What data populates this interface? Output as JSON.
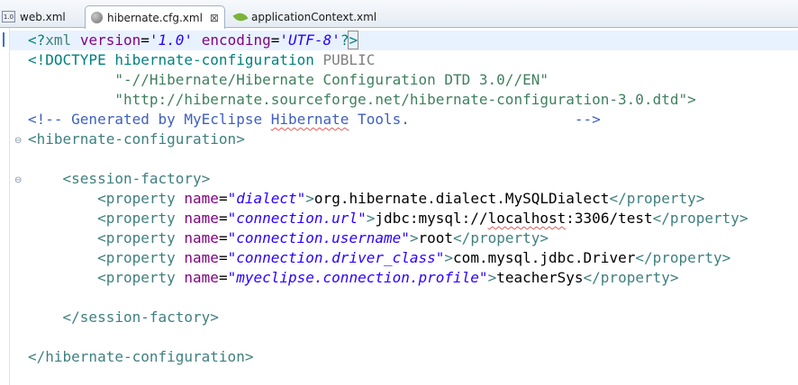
{
  "tabs": [
    {
      "label": "web.xml",
      "icon": "web-xml-icon",
      "active": false
    },
    {
      "label": "hibernate.cfg.xml",
      "icon": "hibernate-icon",
      "active": true,
      "close": "⊠"
    },
    {
      "label": "applicationContext.xml",
      "icon": "spring-leaf-icon",
      "active": false
    }
  ],
  "web_icon_text": "1.0",
  "code": {
    "l1": {
      "a": "<?",
      "b": "xml",
      "c": " ",
      "d": "version",
      "e": "=",
      "f": "'1.0'",
      "g": " ",
      "h": "encoding",
      "i": "=",
      "j": "'UTF-8'",
      "k": "?",
      "l": ">"
    },
    "l2": {
      "a": "<!DOCTYPE",
      "b": " hibernate-configuration ",
      "c": "PUBLIC"
    },
    "l3": {
      "a": "          \"-//Hibernate/Hibernate Configuration DTD 3.0//EN\""
    },
    "l4": {
      "a": "          \"http://hibernate.sourceforge.net/hibernate-configuration-3.0.dtd\">"
    },
    "l5": {
      "a": "<!-- Generated by MyEclipse ",
      "b": "Hibernate",
      "c": " Tools.                   -->"
    },
    "l6": {
      "a": "<hibernate-configuration>"
    },
    "l8": {
      "a": "    <session-factory>"
    },
    "props": [
      {
        "name": "\"dialect\"",
        "pre": "org.hibernate.dialect.MySQLDialect",
        "sq": "",
        "post": ""
      },
      {
        "name": "\"connection.url\"",
        "pre": "jdbc:mysql://",
        "sq": "localhost",
        "post": ":3306/test"
      },
      {
        "name": "\"connection.username\"",
        "pre": "root",
        "sq": "",
        "post": ""
      },
      {
        "name": "\"connection.driver_class\"",
        "pre": "com.mysql.jdbc.Driver",
        "sq": "",
        "post": ""
      },
      {
        "name": "\"myeclipse.connection.profile\"",
        "pre": "teacherSys",
        "sq": "",
        "post": ""
      }
    ],
    "prop_open": "        <property",
    "prop_attr": " name",
    "prop_eq": "=",
    "prop_gt": ">",
    "prop_close": "</property>",
    "l15": {
      "a": "    </session-factory>"
    },
    "l17": {
      "a": "</hibernate-configuration>"
    }
  },
  "colors": {
    "tag": "#3f7f7f",
    "attr": "#7f007f",
    "value": "#2a00ff",
    "comment": "#3f5fbf",
    "string": "#3f7f5f",
    "highlight": "#e8f2fe"
  }
}
